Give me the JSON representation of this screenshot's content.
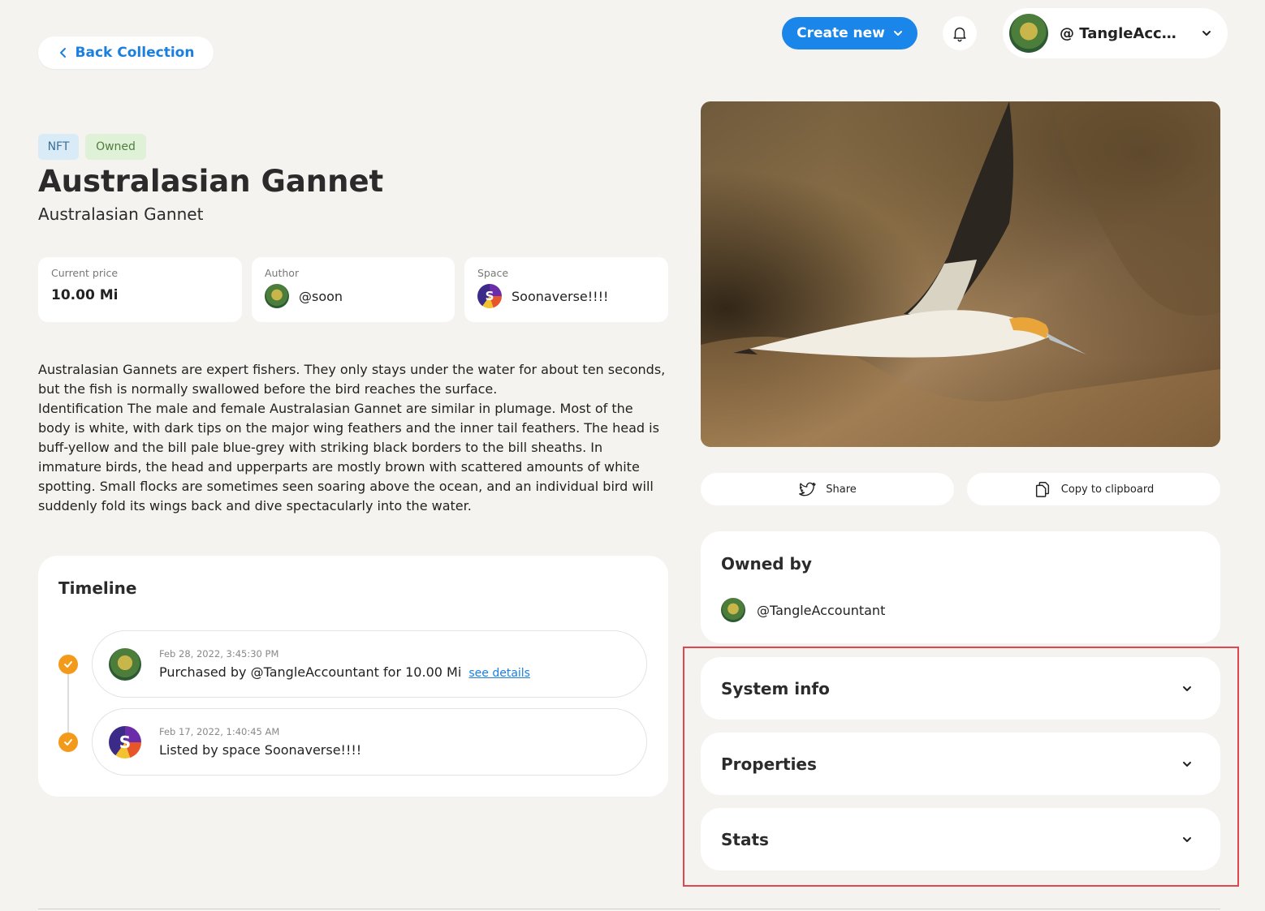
{
  "header": {
    "back_label": "Back Collection",
    "create_label": "Create new",
    "user_name": "@ TangleAccountant"
  },
  "nft": {
    "badges": [
      "NFT",
      "Owned"
    ],
    "title": "Australasian Gannet",
    "subtitle": "Australasian Gannet",
    "price_label": "Current price",
    "price": "10.00 Mi",
    "author_label": "Author",
    "author": "@soon",
    "space_label": "Space",
    "space": "Soonaverse!!!!",
    "description": [
      "Australasian Gannets are expert fishers. They only stays under the water for about ten seconds, but the fish is normally swallowed before the bird reaches the surface.",
      "Identification The male and female Australasian Gannet are similar in plumage. Most of the body is white, with dark tips on the major wing feathers and the inner tail feathers. The head is buff-yellow and the bill pale blue-grey with striking black borders to the bill sheaths. In immature birds, the head and upperparts are mostly brown with scattered amounts of white spotting. Small flocks are sometimes seen soaring above the ocean, and an individual bird will suddenly fold its wings back and dive spectacularly into the water."
    ]
  },
  "timeline": {
    "title": "Timeline",
    "items": [
      {
        "date": "Feb 28, 2022, 3:45:30 PM",
        "text": "Purchased by @TangleAccountant for 10.00 Mi",
        "link": "see details",
        "icon": "user-avatar"
      },
      {
        "date": "Feb 17, 2022, 1:40:45 AM",
        "text": "Listed by space Soonaverse!!!!",
        "icon": "space-avatar"
      }
    ]
  },
  "actions": {
    "share_label": "Share",
    "copy_label": "Copy to clipboard"
  },
  "owned": {
    "title": "Owned by",
    "owner": "@TangleAccountant"
  },
  "accordions": {
    "system_info": "System info",
    "properties": "Properties",
    "stats": "Stats"
  },
  "colors": {
    "accent": "#1b86ea",
    "check": "#f39a1b",
    "highlight": "#e0474c",
    "background": "#f5f3ef"
  }
}
